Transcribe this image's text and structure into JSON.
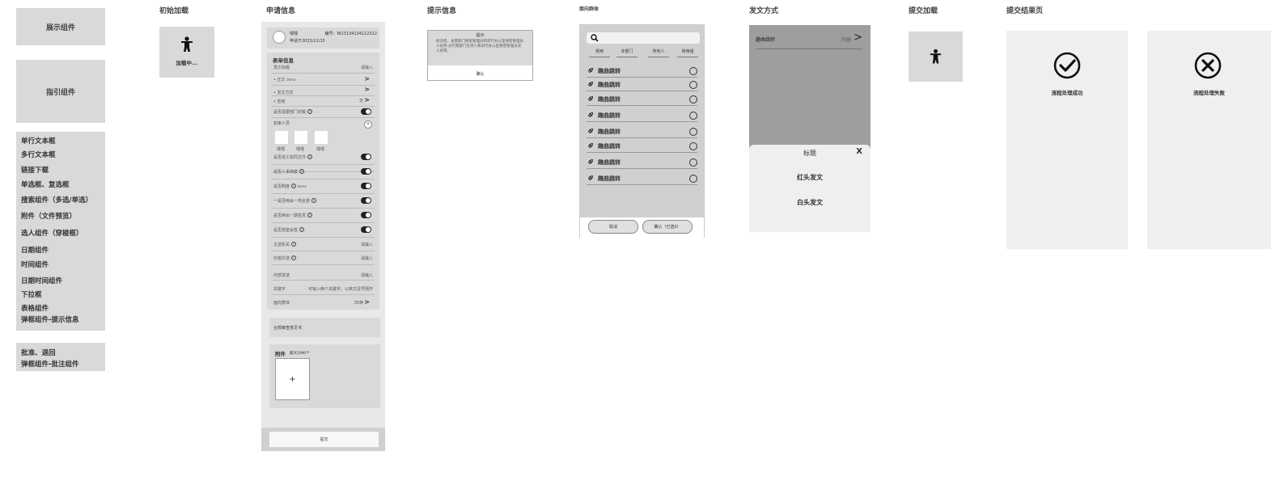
{
  "left_panel": {
    "display_component": "展示组件",
    "guide_component": "指引组件",
    "components": [
      "单行文本框",
      "多行文本框",
      "链接下载",
      "单选框、复选框",
      "搜索组件（多选/单选）",
      "附件（文件预览）",
      "选人组件（穿梭框）",
      "日期组件",
      "时间组件",
      "日期时间组件",
      "下拉框",
      "表格组件",
      "弹框组件-提示信息"
    ],
    "actions": [
      "批准、退回",
      "弹框组件-批注组件"
    ]
  },
  "initial_loading": {
    "title": "初始加载",
    "loading_text": "加载中..."
  },
  "application": {
    "title": "申请信息",
    "user_name": "嘿嘿",
    "serial": "编号：W23134134112312",
    "apply_date": "申请于2023/11/15",
    "form_title": "表单信息",
    "fields": {
      "doc_title_label": "发文标题",
      "doc_title_placeholder": "请输入",
      "body_label": "正文",
      "body_value": "demo",
      "method_label": "发文方式",
      "secret_label": "密级",
      "secret_value": "无",
      "need_dept_label": "是否需要部门初稿",
      "reviewer_label": "初审人员",
      "reviewer_names": [
        "嘿嘿",
        "嘿嘿",
        "嘿嘿"
      ],
      "review_file_label": "是否完工协同文件",
      "personnel_label": "是否人事档案",
      "system_label": "是否制度",
      "system_value": "demo",
      "joint_label": "一是否两会一简全部",
      "two_meetings_label": "是否两会一期签发",
      "internal_label": "是否部室会签",
      "main_send_label": "主送机关",
      "main_send_placeholder": "请输入",
      "cc_label": "抄报抄送",
      "cc_placeholder": "请输入",
      "internal_send_label": "内部发送",
      "internal_send_placeholder": "请输入",
      "keyword_label": "关键字",
      "keyword_placeholder": "可输入两个关键字，以英文逗号隔开",
      "group_label": "面向群体",
      "group_value": "35种"
    },
    "review_note": "合规审查意见书",
    "attachment_title": "附件",
    "attachment_hint": "最大50M/个",
    "attachment_add": "+",
    "submit_label": "提交"
  },
  "tip": {
    "section_title": "提示信息",
    "dialog_title": "提示",
    "dialog_body": "如涉密，总需部门保密管理员和您行办公室保密管理员人初审;分行需部门负责人和旧行办公室保密管理员双人初审。",
    "confirm_label": "确认"
  },
  "audience": {
    "section_title": "面向群体",
    "tabs": [
      "常用",
      "本部门",
      "所有人",
      "常用组"
    ],
    "items": [
      "趣曲跳转",
      "趣曲跳转",
      "趣曲跳转",
      "趣曲跳转",
      "趣曲跳转",
      "趣曲跳转",
      "趣曲跳转",
      "趣曲跳转"
    ],
    "cancel_label": "取消",
    "confirm_label": "确认（已选0）"
  },
  "send_method": {
    "section_title": "发文方式",
    "row_label": "趣曲跳转",
    "row_value": "内容",
    "sheet_title": "标题",
    "close": "X",
    "options": [
      "红头发文",
      "白头发文"
    ]
  },
  "submit_loading": {
    "title": "提交加载"
  },
  "result": {
    "title": "提交结果页",
    "success_text": "流程处理成功",
    "fail_text": "流程处理失败"
  }
}
